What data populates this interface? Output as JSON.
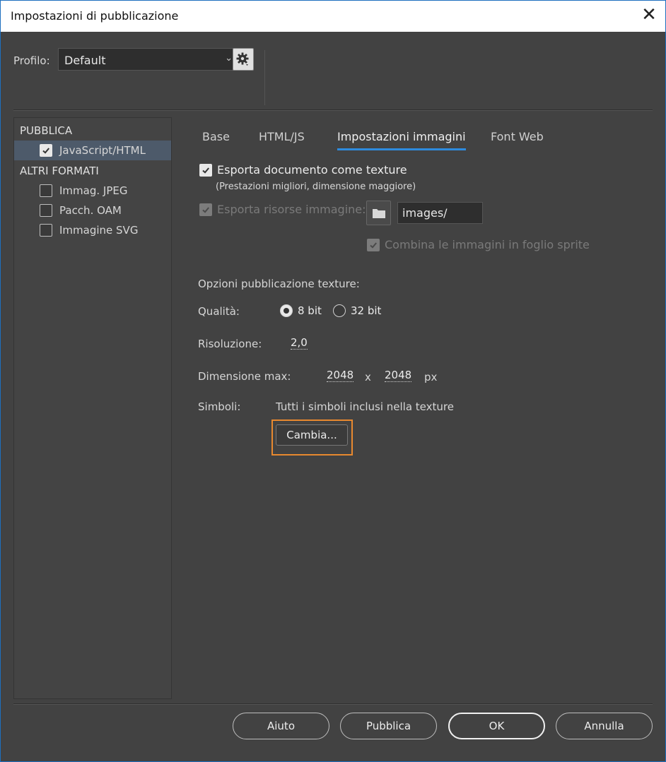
{
  "window": {
    "title": "Impostazioni di pubblicazione",
    "close_glyph": "✕"
  },
  "profile": {
    "label": "Profilo:",
    "value": "Default"
  },
  "sidebar": {
    "section_publish": "PUBBLICA",
    "section_other": "ALTRI FORMATI",
    "items": [
      {
        "label": "JavaScript/HTML",
        "checked": true
      },
      {
        "label": "Immag. JPEG",
        "checked": false
      },
      {
        "label": "Pacch. OAM",
        "checked": false
      },
      {
        "label": "Immagine SVG",
        "checked": false
      }
    ]
  },
  "tabs": [
    "Base",
    "HTML/JS",
    "Impostazioni immagini",
    "Font Web"
  ],
  "active_tab": "Impostazioni immagini",
  "options": {
    "export_texture": {
      "label": "Esporta documento come texture",
      "checked": true
    },
    "export_texture_note": "(Prestazioni migliori, dimensione maggiore)",
    "export_assets": {
      "label": "Esporta risorse immagine:",
      "checked": true,
      "disabled": true
    },
    "assets_path": "images/",
    "sprite_sheet": {
      "label": "Combina le immagini in foglio sprite",
      "checked": true,
      "disabled": true
    }
  },
  "texture": {
    "heading": "Opzioni pubblicazione texture:",
    "quality_label": "Qualità:",
    "quality_options": [
      "8 bit",
      "32 bit"
    ],
    "quality_selected": "8 bit",
    "resolution_label": "Risoluzione:",
    "resolution_value": "2,0",
    "max_size_label": "Dimensione max:",
    "max_width": "2048",
    "times_sign": "x",
    "max_height": "2048",
    "unit": "px",
    "symbols_label": "Simboli:",
    "symbols_value": "Tutti i simboli inclusi nella texture",
    "change_button": "Cambia..."
  },
  "footer": {
    "help": "Aiuto",
    "publish": "Pubblica",
    "ok": "OK",
    "cancel": "Annulla"
  },
  "colors": {
    "accent": "#2e8bde",
    "highlight": "#e8892f",
    "background": "#424242"
  }
}
